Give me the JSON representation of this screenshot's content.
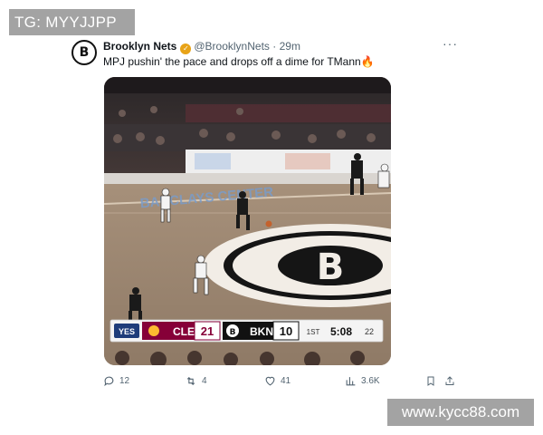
{
  "watermarks": {
    "top": "TG: MYYJJPP",
    "bottom": "www.kycc88.com"
  },
  "tweet": {
    "display_name": "Brooklyn Nets",
    "handle": "@BrooklynNets",
    "separator": "·",
    "time": "29m",
    "text": "MPJ pushin' the pace and drops off a dime for TMann🔥",
    "avatar_letter": "B",
    "more_label": "···"
  },
  "scoreboard": {
    "ad": "YES",
    "away_team": "CLE",
    "away_score": "21",
    "home_team": "BKN",
    "home_score": "10",
    "period": "1ST",
    "clock": "5:08",
    "shot_clock": "22"
  },
  "court": {
    "center_logo": "B",
    "baseline_text": "BARCLAYS CENTER"
  },
  "actions": {
    "replies": "12",
    "reposts": "4",
    "likes": "41",
    "views": "3.6K"
  },
  "colors": {
    "accent_link": "#1d9bf0",
    "cle_wine": "#860038",
    "verified_gold": "#e8a317"
  }
}
